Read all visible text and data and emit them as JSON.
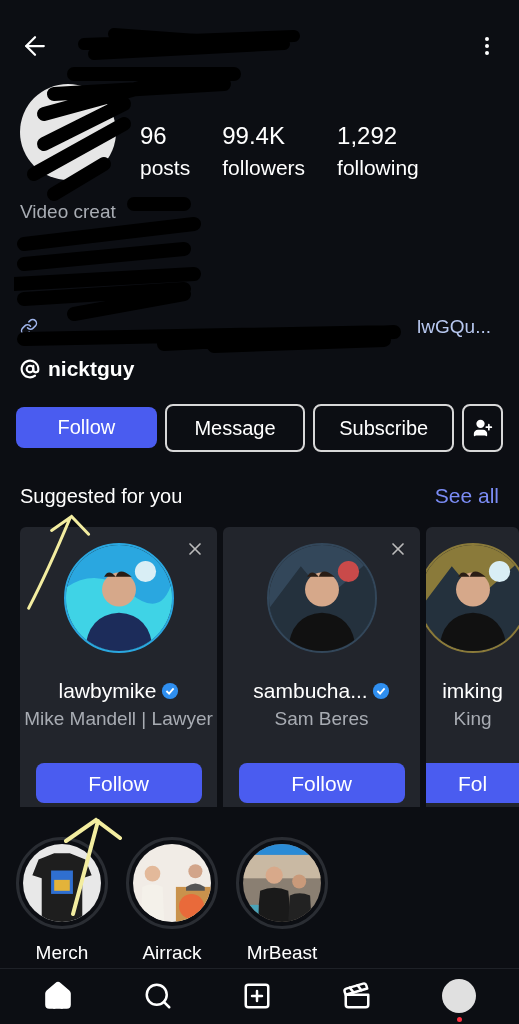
{
  "stats": [
    {
      "value": "96",
      "label": "posts"
    },
    {
      "value": "99.4K",
      "label": "followers"
    },
    {
      "value": "1,292",
      "label": "following"
    }
  ],
  "bio": {
    "category": "Video creat",
    "link": "lwGQu..."
  },
  "threads": {
    "handle": "nicktguy"
  },
  "actions": [
    {
      "kind": "primary",
      "label": "Follow"
    },
    {
      "kind": "outline",
      "label": "Message"
    },
    {
      "kind": "outline",
      "label": "Subscribe"
    },
    {
      "kind": "icon"
    }
  ],
  "suggested": {
    "title": "Suggested for you",
    "see_all": "See all",
    "cards": [
      {
        "username": "lawbymike",
        "verified": true,
        "subtitle": "Mike Mandell | Lawyer",
        "button": "Follow",
        "dismissible": true,
        "color": "#2aa7e0"
      },
      {
        "username": "sambucha...",
        "verified": true,
        "subtitle": "Sam Beres",
        "button": "Follow",
        "dismissible": true,
        "color": "#33475a"
      },
      {
        "username": "imking",
        "verified": false,
        "subtitle": "King",
        "button": "Fol",
        "dismissible": false,
        "color": "#8a7a3a"
      }
    ]
  },
  "highlights": [
    {
      "label": "Merch"
    },
    {
      "label": "Airrack"
    },
    {
      "label": "MrBeast"
    }
  ],
  "nav": [
    {
      "kind": "home",
      "selected": true
    },
    {
      "kind": "search",
      "selected": false
    },
    {
      "kind": "create",
      "selected": false
    },
    {
      "kind": "reels",
      "selected": false
    },
    {
      "kind": "profile",
      "selected": false,
      "badge": true
    }
  ]
}
